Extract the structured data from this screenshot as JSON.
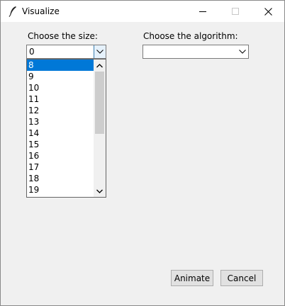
{
  "window": {
    "title": "Visualize",
    "controls": [
      "minimize-icon",
      "maximize-icon",
      "close-icon"
    ]
  },
  "size_selector": {
    "label": "Choose the size:",
    "value": "0",
    "dropdown_open": true,
    "options": [
      "8",
      "9",
      "10",
      "11",
      "12",
      "13",
      "14",
      "15",
      "16",
      "17",
      "18",
      "19"
    ],
    "highlighted_option": "8",
    "scroll_position": 0.0,
    "visible_fraction": 0.55
  },
  "algorithm_selector": {
    "label": "Choose the algorithm:",
    "value": ""
  },
  "buttons": {
    "animate": "Animate",
    "cancel": "Cancel"
  }
}
